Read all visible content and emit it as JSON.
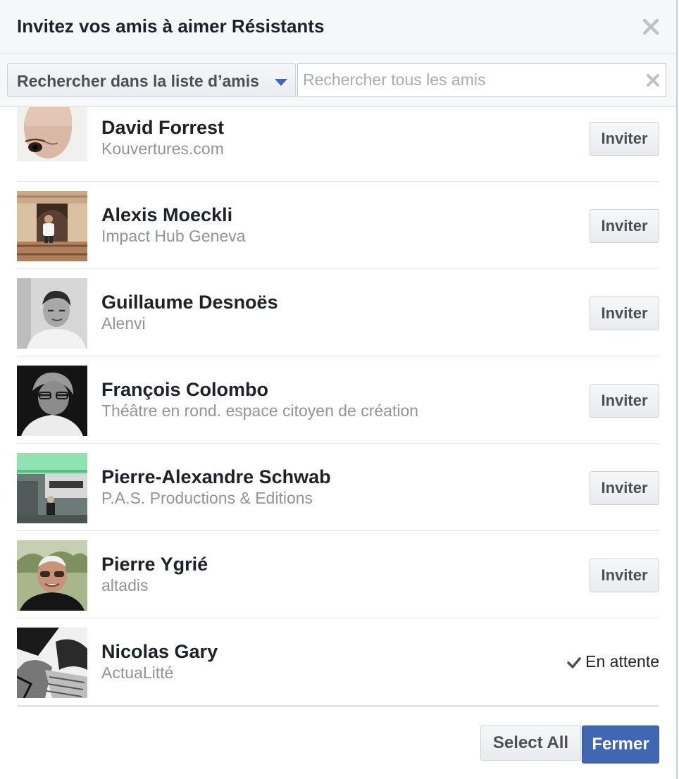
{
  "dialog": {
    "title": "Invitez vos amis à aimer Résistants",
    "close_icon": "close-icon"
  },
  "filter": {
    "dropdown_label": "Rechercher dans la liste d’amis",
    "search_placeholder": "Rechercher tous les amis",
    "search_value": ""
  },
  "friends": [
    {
      "name": "David Forrest",
      "subtitle": "Kouvertures.com",
      "action": "Inviter"
    },
    {
      "name": "Alexis Moeckli",
      "subtitle": "Impact Hub Geneva",
      "action": "Inviter"
    },
    {
      "name": "Guillaume Desnoës",
      "subtitle": "Alenvi",
      "action": "Inviter"
    },
    {
      "name": "François Colombo",
      "subtitle": "Théâtre en rond. espace citoyen de création",
      "action": "Inviter"
    },
    {
      "name": "Pierre-Alexandre Schwab",
      "subtitle": "P.A.S. Productions & Editions",
      "action": "Inviter"
    },
    {
      "name": "Pierre Ygrié",
      "subtitle": "altadis",
      "action": "Inviter"
    },
    {
      "name": "Nicolas Gary",
      "subtitle": "ActuaLitté",
      "status": "En attente"
    }
  ],
  "footer": {
    "select_all_label": "Select All",
    "close_label": "Fermer"
  },
  "colors": {
    "primary": "#4267b2",
    "header_bg": "#f6f7f9",
    "subtitle_text": "#90949c"
  }
}
